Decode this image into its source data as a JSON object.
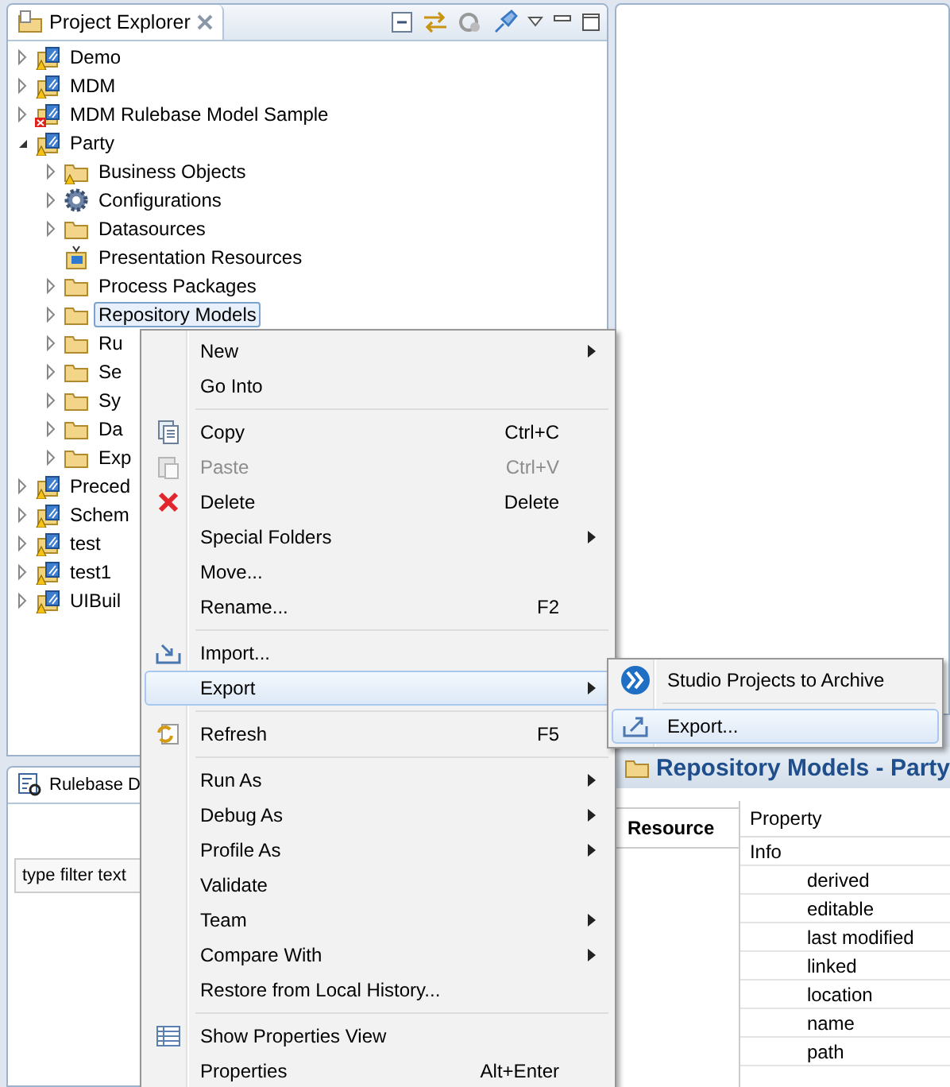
{
  "explorer": {
    "title": "Project Explorer",
    "tree": [
      {
        "label": "Demo",
        "kind": "project",
        "warning": true,
        "error": false,
        "expandable": true,
        "expanded": false,
        "selected": false
      },
      {
        "label": "MDM",
        "kind": "project",
        "warning": true,
        "error": false,
        "expandable": true,
        "expanded": false,
        "selected": false
      },
      {
        "label": "MDM Rulebase Model Sample",
        "kind": "project",
        "warning": false,
        "error": true,
        "expandable": true,
        "expanded": false,
        "selected": false
      },
      {
        "label": "Party",
        "kind": "project",
        "warning": true,
        "error": false,
        "expandable": true,
        "expanded": true,
        "selected": false,
        "children": [
          {
            "label": "Business Objects",
            "kind": "folder",
            "warning": true,
            "error": false,
            "expandable": true,
            "expanded": false,
            "selected": false
          },
          {
            "label": "Configurations",
            "kind": "gear",
            "warning": false,
            "error": false,
            "expandable": true,
            "expanded": false,
            "selected": false
          },
          {
            "label": "Datasources",
            "kind": "folder",
            "warning": false,
            "error": false,
            "expandable": true,
            "expanded": false,
            "selected": false
          },
          {
            "label": "Presentation Resources",
            "kind": "monitor",
            "warning": false,
            "error": false,
            "expandable": false,
            "expanded": false,
            "selected": false
          },
          {
            "label": "Process Packages",
            "kind": "folder",
            "warning": false,
            "error": false,
            "expandable": true,
            "expanded": false,
            "selected": false
          },
          {
            "label": "Repository Models",
            "kind": "folder",
            "warning": false,
            "error": false,
            "expandable": true,
            "expanded": false,
            "selected": true
          },
          {
            "label": "Ru",
            "kind": "folder",
            "warning": false,
            "error": false,
            "expandable": true,
            "expanded": false,
            "selected": false
          },
          {
            "label": "Se",
            "kind": "folder",
            "warning": false,
            "error": false,
            "expandable": true,
            "expanded": false,
            "selected": false
          },
          {
            "label": "Sy",
            "kind": "folder",
            "warning": false,
            "error": false,
            "expandable": true,
            "expanded": false,
            "selected": false
          },
          {
            "label": "Da",
            "kind": "folder",
            "warning": false,
            "error": false,
            "expandable": true,
            "expanded": false,
            "selected": false
          },
          {
            "label": "Exp",
            "kind": "folder",
            "warning": false,
            "error": false,
            "expandable": true,
            "expanded": false,
            "selected": false
          }
        ]
      },
      {
        "label": "Preced",
        "kind": "project",
        "warning": true,
        "error": false,
        "expandable": true,
        "expanded": false,
        "selected": false
      },
      {
        "label": "Schem",
        "kind": "project",
        "warning": true,
        "error": false,
        "expandable": true,
        "expanded": false,
        "selected": false
      },
      {
        "label": "test",
        "kind": "project",
        "warning": true,
        "error": false,
        "expandable": true,
        "expanded": false,
        "selected": false
      },
      {
        "label": "test1",
        "kind": "project",
        "warning": true,
        "error": false,
        "expandable": true,
        "expanded": false,
        "selected": false
      },
      {
        "label": "UIBuil",
        "kind": "project",
        "warning": true,
        "error": false,
        "expandable": true,
        "expanded": false,
        "selected": false
      }
    ]
  },
  "rulebase_panel": {
    "title": "Rulebase D",
    "filter": {
      "placeholder": "type filter text"
    }
  },
  "editor": {
    "title": "Repository Models - Party",
    "tabs": [
      {
        "label": "Resource",
        "selected": true
      }
    ],
    "properties": {
      "column": "Property",
      "rows": [
        {
          "label": "Info",
          "children": [
            {
              "label": "derived"
            },
            {
              "label": "editable"
            },
            {
              "label": "last modified"
            },
            {
              "label": "linked"
            },
            {
              "label": "location"
            },
            {
              "label": "name"
            },
            {
              "label": "path"
            }
          ]
        }
      ]
    }
  },
  "context_menu": {
    "items": [
      {
        "kind": "item",
        "label": "New",
        "submenu": true,
        "disabled": false,
        "selected": false
      },
      {
        "kind": "item",
        "label": "Go Into",
        "submenu": false,
        "disabled": false,
        "selected": false
      },
      {
        "kind": "separator"
      },
      {
        "kind": "item",
        "label": "Copy",
        "shortcut": "Ctrl+C",
        "submenu": false,
        "disabled": false,
        "selected": false
      },
      {
        "kind": "item",
        "label": "Paste",
        "shortcut": "Ctrl+V",
        "submenu": false,
        "disabled": true,
        "selected": false
      },
      {
        "kind": "item",
        "label": "Delete",
        "shortcut": "Delete",
        "submenu": false,
        "disabled": false,
        "selected": false
      },
      {
        "kind": "item",
        "label": "Special Folders",
        "submenu": true,
        "disabled": false,
        "selected": false
      },
      {
        "kind": "item",
        "label": "Move...",
        "submenu": false,
        "disabled": false,
        "selected": false
      },
      {
        "kind": "item",
        "label": "Rename...",
        "shortcut": "F2",
        "submenu": false,
        "disabled": false,
        "selected": false
      },
      {
        "kind": "separator"
      },
      {
        "kind": "item",
        "label": "Import...",
        "submenu": false,
        "disabled": false,
        "selected": false
      },
      {
        "kind": "item",
        "label": "Export",
        "submenu": true,
        "disabled": false,
        "selected": true
      },
      {
        "kind": "separator"
      },
      {
        "kind": "item",
        "label": "Refresh",
        "shortcut": "F5",
        "submenu": false,
        "disabled": false,
        "selected": false
      },
      {
        "kind": "separator"
      },
      {
        "kind": "item",
        "label": "Run As",
        "submenu": true,
        "disabled": false,
        "selected": false
      },
      {
        "kind": "item",
        "label": "Debug As",
        "submenu": true,
        "disabled": false,
        "selected": false
      },
      {
        "kind": "item",
        "label": "Profile As",
        "submenu": true,
        "disabled": false,
        "selected": false
      },
      {
        "kind": "item",
        "label": "Validate",
        "submenu": false,
        "disabled": false,
        "selected": false
      },
      {
        "kind": "item",
        "label": "Team",
        "submenu": true,
        "disabled": false,
        "selected": false
      },
      {
        "kind": "item",
        "label": "Compare With",
        "submenu": true,
        "disabled": false,
        "selected": false
      },
      {
        "kind": "item",
        "label": "Restore from Local History...",
        "submenu": false,
        "disabled": false,
        "selected": false
      },
      {
        "kind": "separator"
      },
      {
        "kind": "item",
        "label": "Show Properties View",
        "submenu": false,
        "disabled": false,
        "selected": false
      },
      {
        "kind": "item",
        "label": "Properties",
        "shortcut": "Alt+Enter",
        "submenu": false,
        "disabled": false,
        "selected": false
      }
    ]
  },
  "export_submenu": {
    "items": [
      {
        "kind": "item",
        "label": "Studio Projects to Archive",
        "selected": false
      },
      {
        "kind": "separator"
      },
      {
        "kind": "item",
        "label": "Export...",
        "selected": true
      }
    ]
  }
}
